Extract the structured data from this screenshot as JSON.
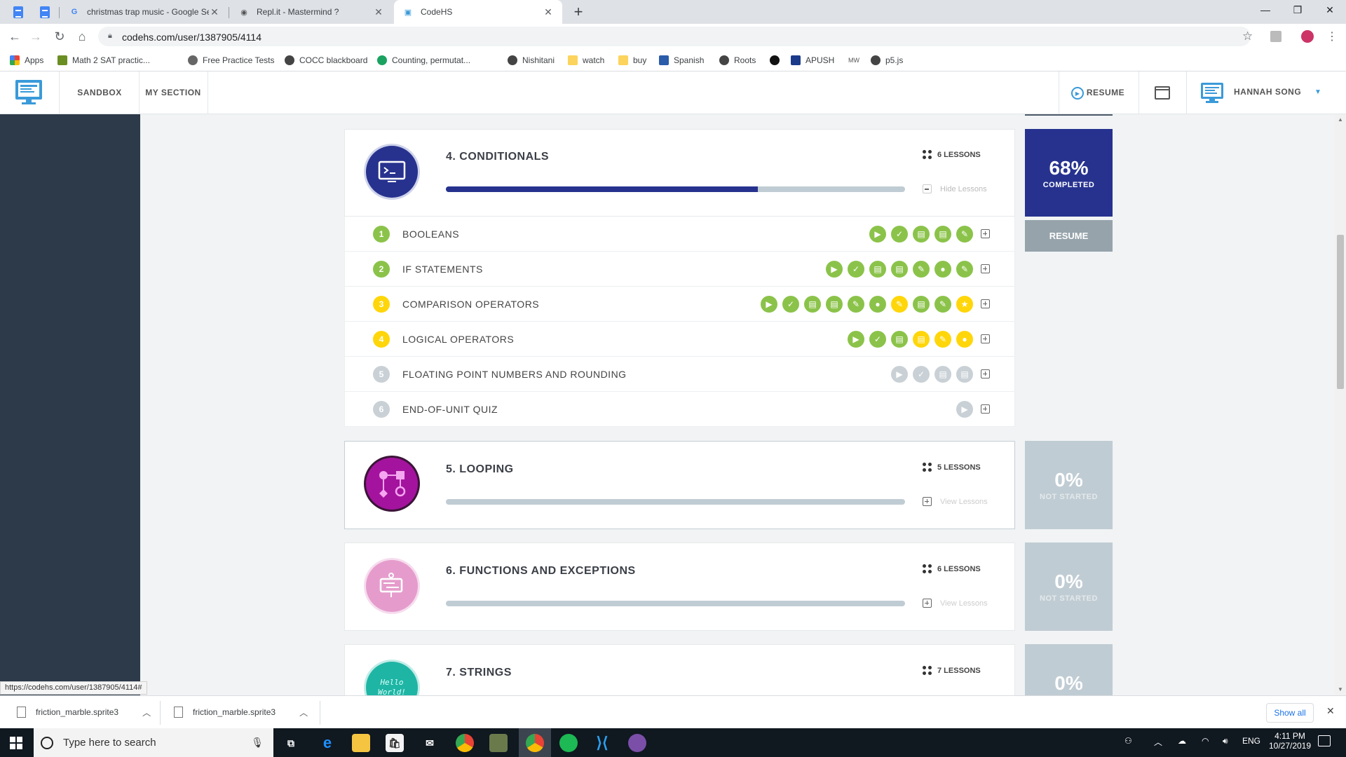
{
  "browser": {
    "tabs": [
      {
        "title": "christmas trap music - Google Se",
        "icon": "google-icon"
      },
      {
        "title": "Repl.it - Mastermind ?",
        "icon": "replit-icon"
      },
      {
        "title": "CodeHS",
        "icon": "codehs-icon"
      }
    ],
    "url": "codehs.com/user/1387905/4114",
    "bookmarks": [
      "Apps",
      "Math 2 SAT practic...",
      "Free Practice Tests",
      "COCC blackboard",
      "Counting, permutat...",
      "Nishitani",
      "watch",
      "buy",
      "Spanish",
      "Roots",
      "APUSH",
      "p5.js"
    ],
    "status_url": "https://codehs.com/user/1387905/4114#"
  },
  "app": {
    "nav": {
      "sandbox": "SANDBOX",
      "my_section": "MY SECTION",
      "resume": "RESUME",
      "user_name": "HANNAH SONG"
    }
  },
  "units": [
    {
      "title": "4. CONDITIONALS",
      "lessons_count": "6 LESSONS",
      "toggle_label": "Hide Lessons",
      "progress": 0.68,
      "stat_pct": "68%",
      "stat_label": "COMPLETED",
      "resume_label": "RESUME",
      "icon_color": "#27328f",
      "lessons": [
        {
          "num": "1",
          "name": "BOOLEANS",
          "state": "done"
        },
        {
          "num": "2",
          "name": "IF STATEMENTS",
          "state": "done"
        },
        {
          "num": "3",
          "name": "COMPARISON OPERATORS",
          "state": "partial"
        },
        {
          "num": "4",
          "name": "LOGICAL OPERATORS",
          "state": "partial"
        },
        {
          "num": "5",
          "name": "FLOATING POINT NUMBERS AND ROUNDING",
          "state": "none"
        },
        {
          "num": "6",
          "name": "END-OF-UNIT QUIZ",
          "state": "none"
        }
      ]
    },
    {
      "title": "5. LOOPING",
      "lessons_count": "5 LESSONS",
      "toggle_label": "View Lessons",
      "progress": 0,
      "stat_pct": "0%",
      "stat_label": "NOT STARTED",
      "icon_color": "#a4139e"
    },
    {
      "title": "6. FUNCTIONS AND EXCEPTIONS",
      "lessons_count": "6 LESSONS",
      "toggle_label": "View Lessons",
      "progress": 0,
      "stat_pct": "0%",
      "stat_label": "NOT STARTED",
      "icon_color": "#e59ccc"
    },
    {
      "title": "7. STRINGS",
      "lessons_count": "7 LESSONS",
      "stat_pct": "0%",
      "icon_color": "#1fb5a5",
      "icon_text": "Hello World!"
    }
  ],
  "lesson_activities": [
    [
      "g",
      "g",
      "g",
      "g",
      "g"
    ],
    [
      "g",
      "g",
      "g",
      "g",
      "g",
      "g",
      "g"
    ],
    [
      "g",
      "g",
      "g",
      "g",
      "g",
      "g",
      "y",
      "g",
      "g",
      "y"
    ],
    [
      "g",
      "g",
      "g",
      "y",
      "y",
      "y"
    ],
    [
      "gr",
      "gr",
      "gr",
      "gr"
    ],
    [
      "gr"
    ]
  ],
  "downloads": [
    "friction_marble.sprite3",
    "friction_marble.sprite3"
  ],
  "show_all": "Show all",
  "taskbar": {
    "search_placeholder": "Type here to search",
    "lang": "ENG",
    "time": "4:11 PM",
    "date": "10/27/2019"
  },
  "colors": {
    "done": "#8bc34a",
    "partial": "#ffd60a",
    "none": "#c9d1d6",
    "brand": "#27328f"
  }
}
